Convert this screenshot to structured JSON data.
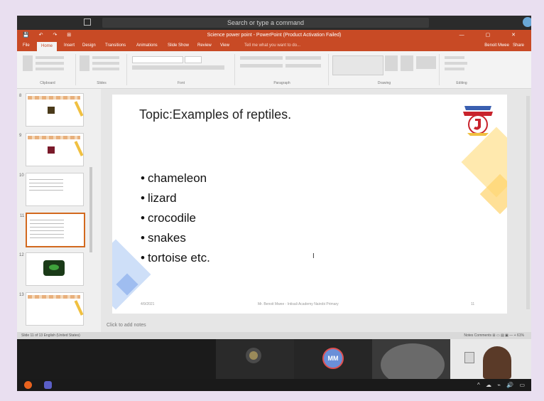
{
  "os": {
    "search_placeholder": "Search or type a command"
  },
  "app": {
    "window_title": "Science power point - PowerPoint (Product Activation Failed)",
    "quick_access": "💾 ↶ ↷ ⊞",
    "window_controls": "— ▢ ✕",
    "tabs": [
      "File",
      "Home",
      "Insert",
      "Design",
      "Transitions",
      "Animations",
      "Slide Show",
      "Review",
      "View"
    ],
    "active_tab_index": 1,
    "tell_me": "Tell me what you want to do...",
    "user": "Benoit Mwee",
    "share": "Share",
    "ribbon_groups": [
      "Clipboard",
      "Slides",
      "Font",
      "Paragraph",
      "Drawing",
      "Editing"
    ]
  },
  "thumbnails": [
    {
      "num": "8",
      "kind": "flowers-pic"
    },
    {
      "num": "9",
      "kind": "flowers-pic"
    },
    {
      "num": "10",
      "kind": "text"
    },
    {
      "num": "11",
      "kind": "text",
      "selected": true
    },
    {
      "num": "12",
      "kind": "chameleon"
    },
    {
      "num": "13",
      "kind": "flowers-pic"
    }
  ],
  "slide": {
    "title": "Topic:Examples of reptiles.",
    "bullets": [
      "chameleon",
      "lizard",
      "crocodile",
      "snakes",
      "tortoise etc."
    ],
    "footer_date": "4/9/2021",
    "footer_text": "Mr. Benoit Mwee - Intisali Academy Nairobi Primary",
    "footer_page": "11"
  },
  "notes_placeholder": "Click to add notes",
  "status": {
    "left": "Slide 11 of 13   English (United States)",
    "right": "Notes   Comments   ⊞  ▭  ▤  ▣   —  +   61%"
  },
  "meeting": {
    "participant_initials": "MM"
  },
  "tray": "^ ☁ ⌁ 🔊 ▭"
}
